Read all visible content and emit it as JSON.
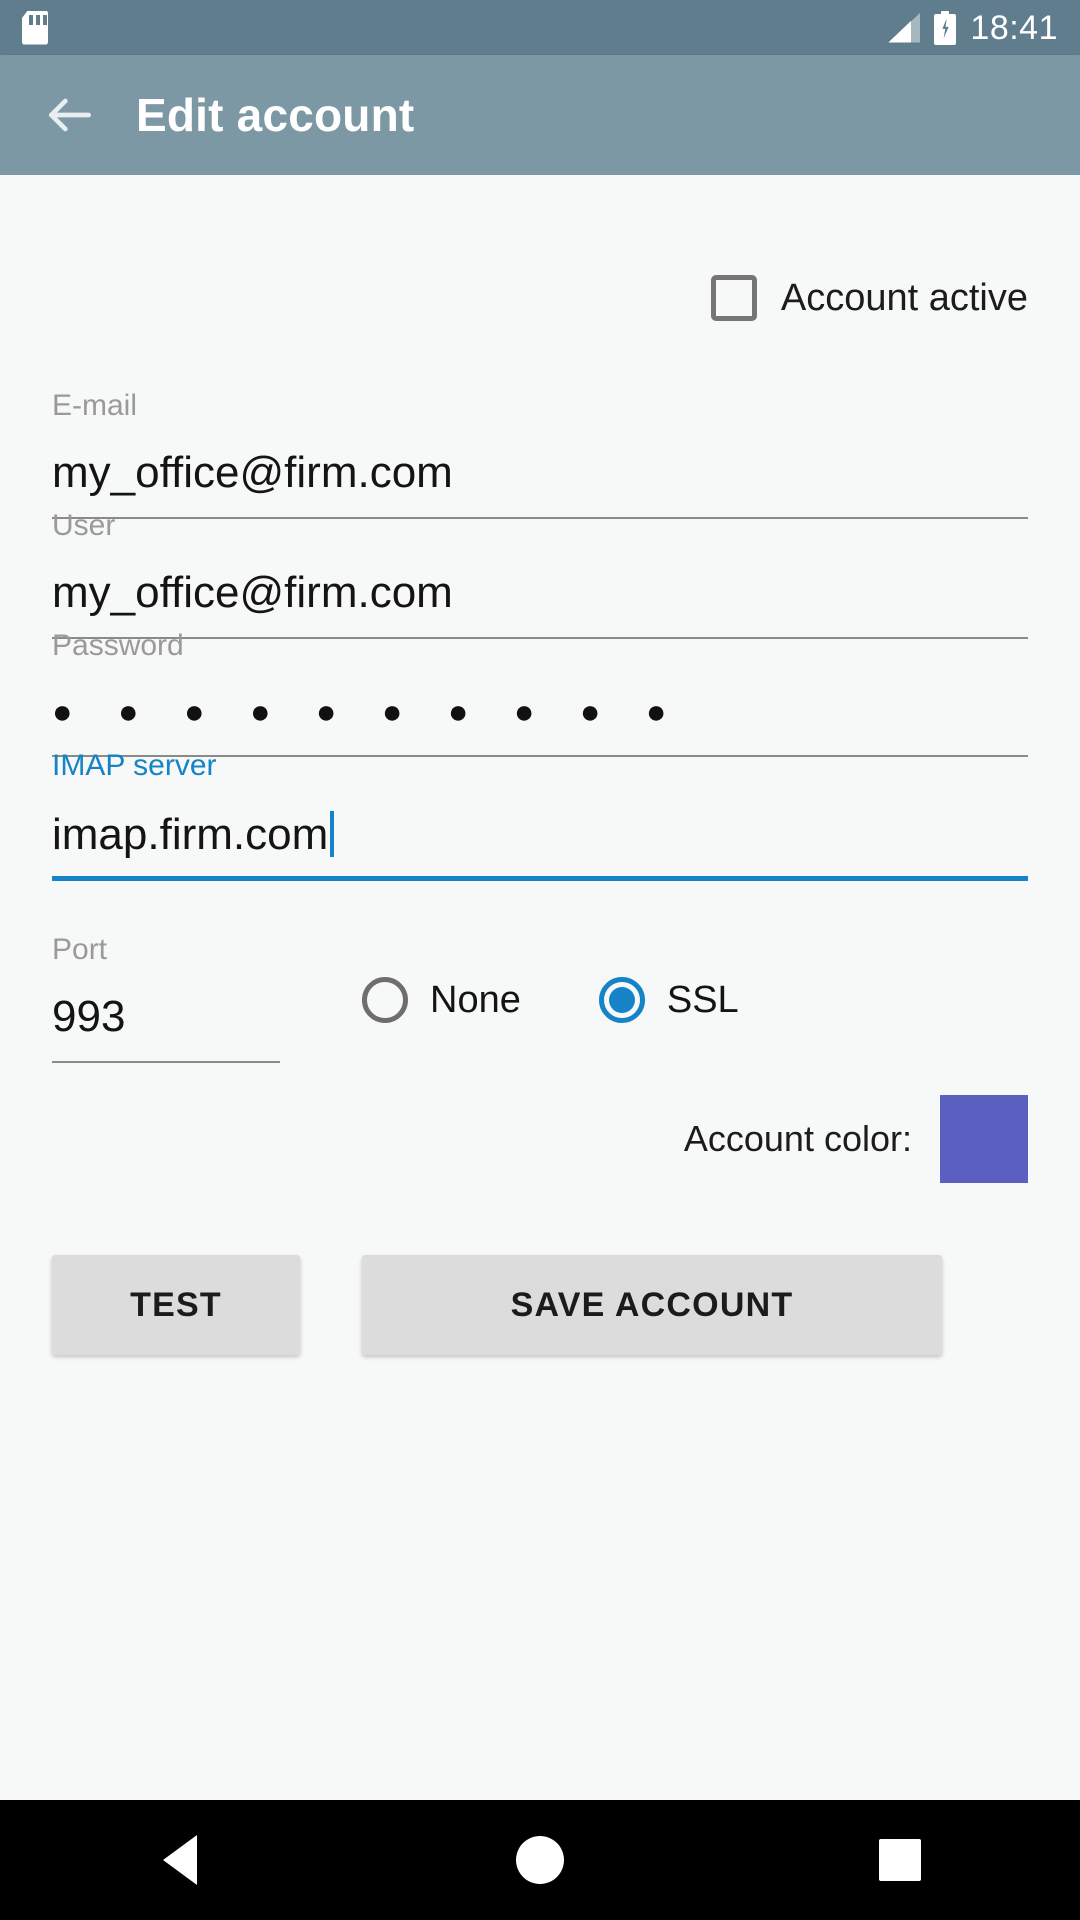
{
  "status_bar": {
    "sd_card_icon": "sd-card-icon",
    "signal_icon": "signal-icon",
    "battery_icon": "battery-charging-icon",
    "time": "18:41",
    "background_color": "#5f7d8c"
  },
  "app_bar": {
    "back_icon": "back-arrow-icon",
    "title": "Edit account",
    "background_color": "#7d98a5"
  },
  "form": {
    "account_active": {
      "label": "Account active",
      "checked": false
    },
    "email": {
      "label": "E-mail",
      "value": "my_office@firm.com",
      "focused": false
    },
    "user": {
      "label": "User",
      "value": "my_office@firm.com",
      "focused": false
    },
    "password": {
      "label": "Password",
      "value": "● ● ● ● ● ● ● ● ● ●",
      "dot_count": 10,
      "focused": false
    },
    "imap_server": {
      "label": "IMAP server",
      "value": "imap.firm.com",
      "focused": true,
      "accent_color": "#1583c6"
    },
    "port": {
      "label": "Port",
      "value": "993",
      "focused": false
    },
    "security": {
      "options": [
        {
          "label": "None",
          "selected": false
        },
        {
          "label": "SSL",
          "selected": true
        }
      ],
      "selected_value": "SSL",
      "accent_color": "#1583c6"
    },
    "account_color": {
      "label": "Account color:",
      "swatch_color": "#5b5fc0"
    }
  },
  "actions": {
    "test_label": "TEST",
    "save_label": "SAVE ACCOUNT"
  },
  "nav_bar": {
    "back_icon": "nav-back-triangle-icon",
    "home_icon": "nav-home-circle-icon",
    "recents_icon": "nav-recents-square-icon"
  }
}
